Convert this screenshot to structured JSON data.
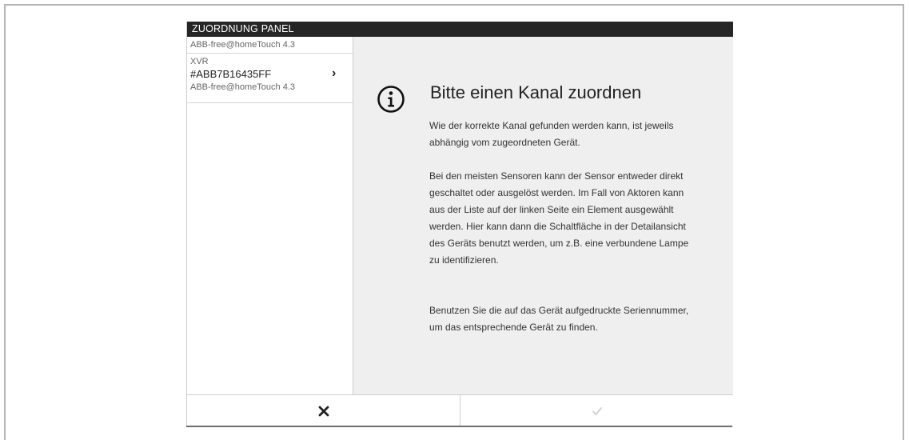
{
  "panel": {
    "title": "ZUORDNUNG PANEL"
  },
  "sidebar": {
    "breadcrumb": "ABB-free@homeTouch 4.3",
    "items": [
      {
        "type": "XVR",
        "id": "#ABB7B16435FF",
        "subtitle": "ABB-free@homeTouch 4.3",
        "chevron": "›"
      }
    ]
  },
  "detail": {
    "icon": "info-icon",
    "heading": "Bitte einen Kanal zuordnen",
    "paragraphs": [
      "Wie der korrekte Kanal gefunden werden kann, ist jeweils abhängig vom zugeordneten Gerät.",
      "Bei den meisten Sensoren kann der Sensor entweder direkt geschaltet oder ausgelöst werden. Im Fall von Aktoren kann aus der Liste auf der linken Seite ein Element ausgewählt werden. Hier kann dann die Schaltfläche in der Detailansicht des Geräts benutzt werden, um z.B. eine verbundene Lampe zu identifizieren.",
      "Benutzen Sie die auf das Gerät aufgedruckte Seriennummer, um das entsprechende Gerät zu finden."
    ]
  },
  "footer": {
    "cancel_icon": "close-icon",
    "confirm_icon": "check-icon"
  },
  "colors": {
    "titlebar": "#262626",
    "detail_bg": "#efefef",
    "confirm_disabled": "#cfcfcf"
  }
}
